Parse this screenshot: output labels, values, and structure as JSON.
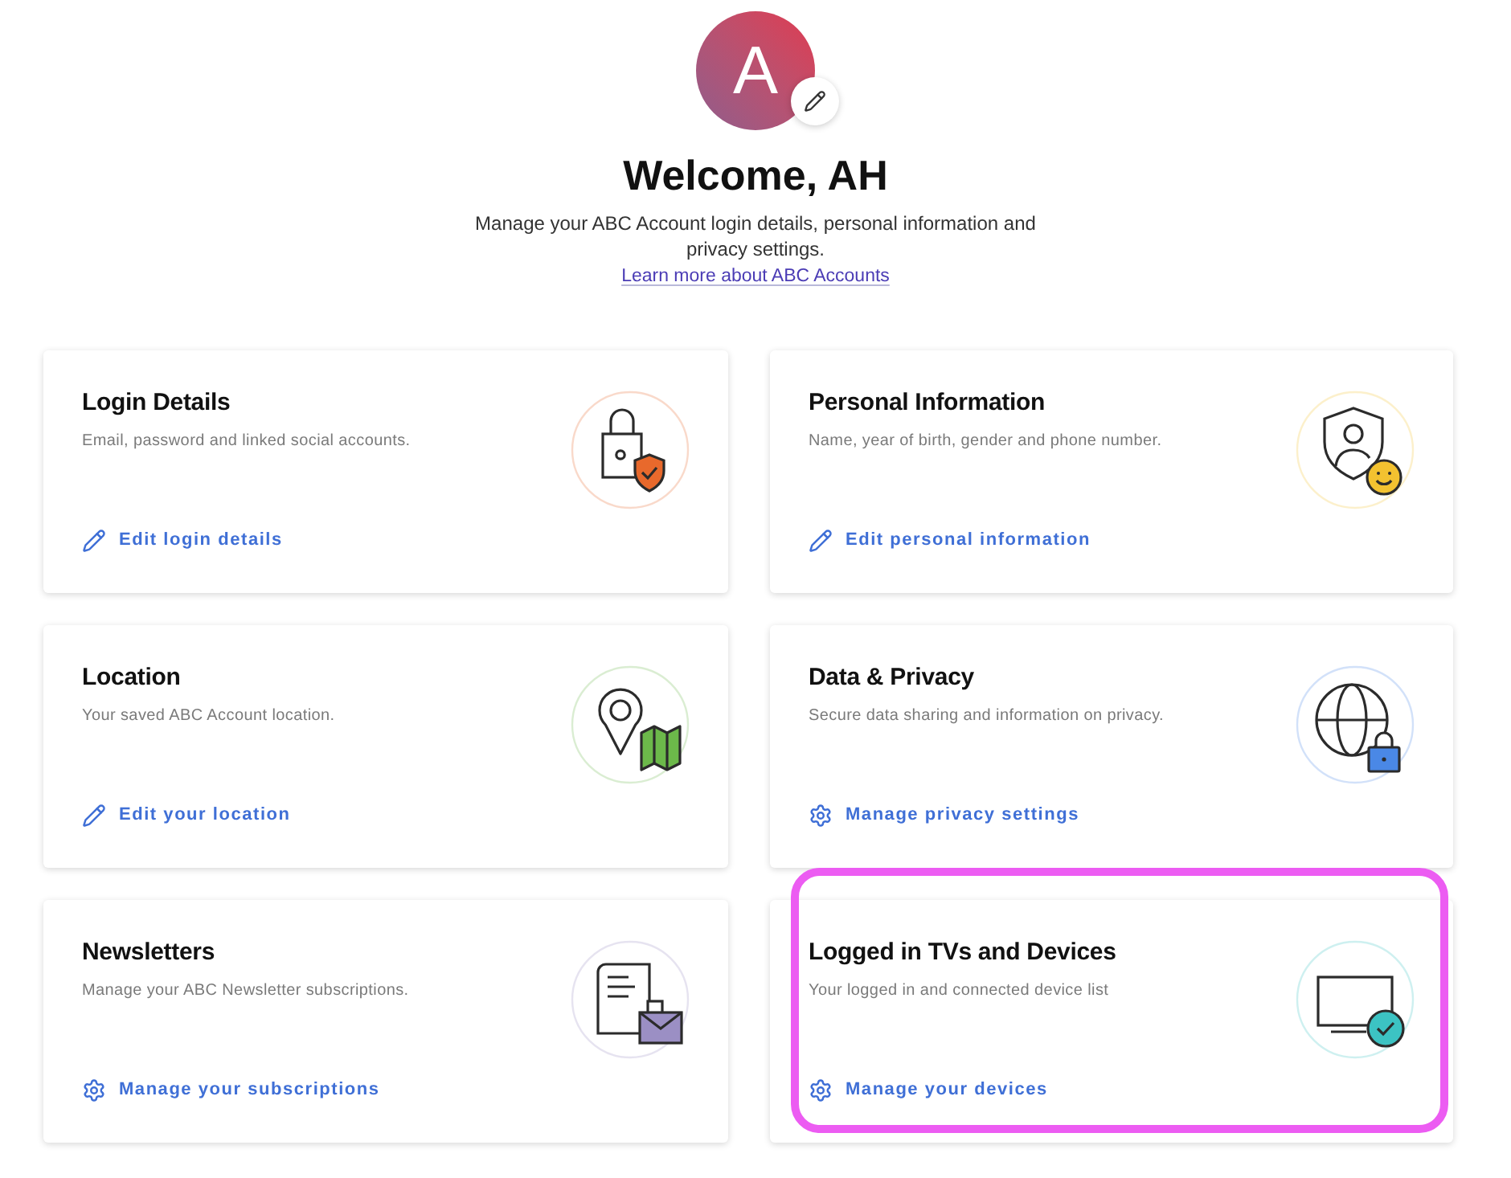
{
  "avatar": {
    "initial": "A"
  },
  "welcome": {
    "title": "Welcome, AH",
    "description": "Manage your ABC Account login details, personal information and privacy settings.",
    "link": "Learn more about ABC Accounts"
  },
  "cards": [
    {
      "title": "Login Details",
      "description": "Email, password and linked social accounts.",
      "link": {
        "label": "Edit login details",
        "kind": "edit"
      },
      "color": "#e8692c",
      "highlighted": false
    },
    {
      "title": "Personal Information",
      "description": "Name, year of birth, gender and phone number.",
      "link": {
        "label": "Edit personal information",
        "kind": "edit"
      },
      "color": "#f3c230",
      "highlighted": false
    },
    {
      "title": "Location",
      "description": "Your saved ABC Account location.",
      "link": {
        "label": "Edit your location",
        "kind": "edit"
      },
      "color": "#6cb94a",
      "highlighted": false
    },
    {
      "title": "Data & Privacy",
      "description": "Secure data sharing and information on privacy.",
      "link": {
        "label": "Manage privacy settings",
        "kind": "settings"
      },
      "color": "#4a88e6",
      "highlighted": false
    },
    {
      "title": "Newsletters",
      "description": "Manage your ABC Newsletter subscriptions.",
      "link": {
        "label": "Manage your subscriptions",
        "kind": "settings"
      },
      "color": "#9b8fc4",
      "highlighted": false
    },
    {
      "title": "Logged in TVs and Devices",
      "description": "Your logged in and connected device list",
      "link": {
        "label": "Manage your devices",
        "kind": "settings"
      },
      "color": "#3cc3c3",
      "highlighted": true
    }
  ]
}
